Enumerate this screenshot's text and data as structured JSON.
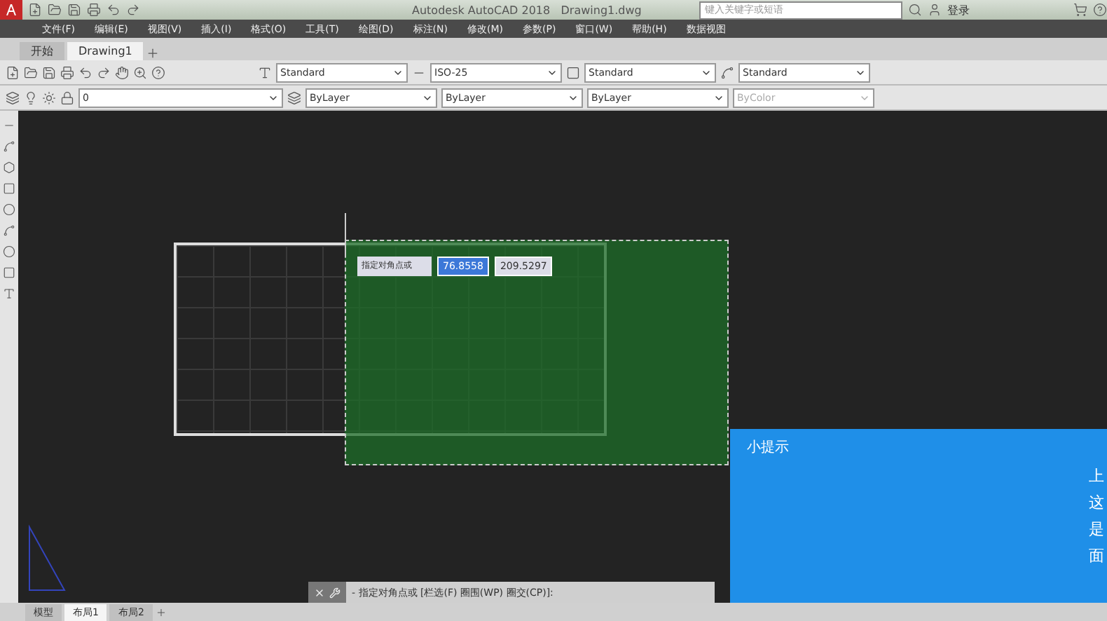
{
  "window": {
    "title": "Autodesk AutoCAD 2018",
    "document": "Drawing1.dwg"
  },
  "search": {
    "placeholder": "键入关键字或短语"
  },
  "sign_in": {
    "label": "登录"
  },
  "menu": [
    "文件(F)",
    "编辑(E)",
    "视图(V)",
    "插入(I)",
    "格式(O)",
    "工具(T)",
    "绘图(D)",
    "标注(N)",
    "修改(M)",
    "参数(P)",
    "窗口(W)",
    "帮助(H)",
    "数据视图"
  ],
  "doc_tabs": [
    {
      "label": "开始",
      "selected": false
    },
    {
      "label": "Drawing1",
      "selected": true
    }
  ],
  "style_dropdowns": [
    {
      "kind": "text",
      "value": "Standard"
    },
    {
      "kind": "dim",
      "value": "ISO-25"
    },
    {
      "kind": "table",
      "value": "Standard"
    },
    {
      "kind": "leader",
      "value": "Standard"
    }
  ],
  "layer": {
    "value": "0"
  },
  "property_dropdowns": [
    {
      "value": "ByLayer",
      "disabled": false
    },
    {
      "value": "ByLayer",
      "disabled": false
    },
    {
      "value": "ByLayer",
      "disabled": false
    },
    {
      "value": "ByColor",
      "disabled": true
    }
  ],
  "dynamic_input": {
    "prompt": "指定对角点或",
    "fields": [
      {
        "value": "76.8558",
        "selected": true
      },
      {
        "value": "209.5297",
        "selected": false
      }
    ]
  },
  "command_line": {
    "text": "- 指定对角点或 [栏选(F) 圈围(WP) 圈交(CP)]:"
  },
  "layout_tabs": [
    {
      "label": "模型",
      "selected": false
    },
    {
      "label": "布局1",
      "selected": true
    },
    {
      "label": "布局2",
      "selected": false
    }
  ],
  "tip_panel": {
    "title": "小提示",
    "lines": [
      "上",
      "这",
      "是",
      "面"
    ]
  }
}
